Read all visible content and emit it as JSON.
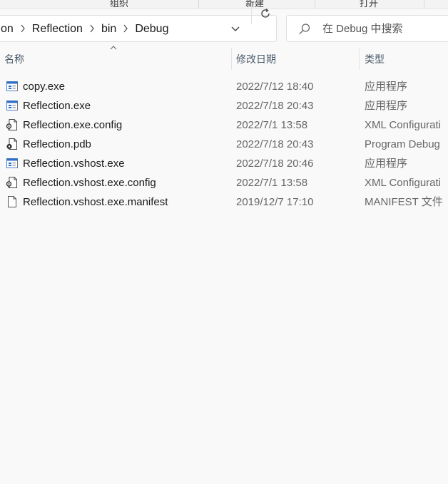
{
  "ribbon": {
    "groups": [
      "组织",
      "新建",
      "打开"
    ]
  },
  "address": {
    "crumbs": [
      "on",
      "Reflection",
      "bin",
      "Debug"
    ]
  },
  "search": {
    "placeholder": "在 Debug 中搜索"
  },
  "columns": {
    "name": "名称",
    "date": "修改日期",
    "type": "类型"
  },
  "files": [
    {
      "name": "copy.exe",
      "date": "2022/7/12 18:40",
      "type": "应用程序",
      "icon": "exe-icon"
    },
    {
      "name": "Reflection.exe",
      "date": "2022/7/18 20:43",
      "type": "应用程序",
      "icon": "exe-icon"
    },
    {
      "name": "Reflection.exe.config",
      "date": "2022/7/1 13:58",
      "type": "XML Configurati",
      "icon": "config-icon"
    },
    {
      "name": "Reflection.pdb",
      "date": "2022/7/18 20:43",
      "type": "Program Debug",
      "icon": "pdb-icon"
    },
    {
      "name": "Reflection.vshost.exe",
      "date": "2022/7/18 20:46",
      "type": "应用程序",
      "icon": "exe-icon"
    },
    {
      "name": "Reflection.vshost.exe.config",
      "date": "2022/7/1 13:58",
      "type": "XML Configurati",
      "icon": "config-icon"
    },
    {
      "name": "Reflection.vshost.exe.manifest",
      "date": "2019/12/7 17:10",
      "type": "MANIFEST 文件",
      "icon": "blank-file-icon"
    }
  ]
}
